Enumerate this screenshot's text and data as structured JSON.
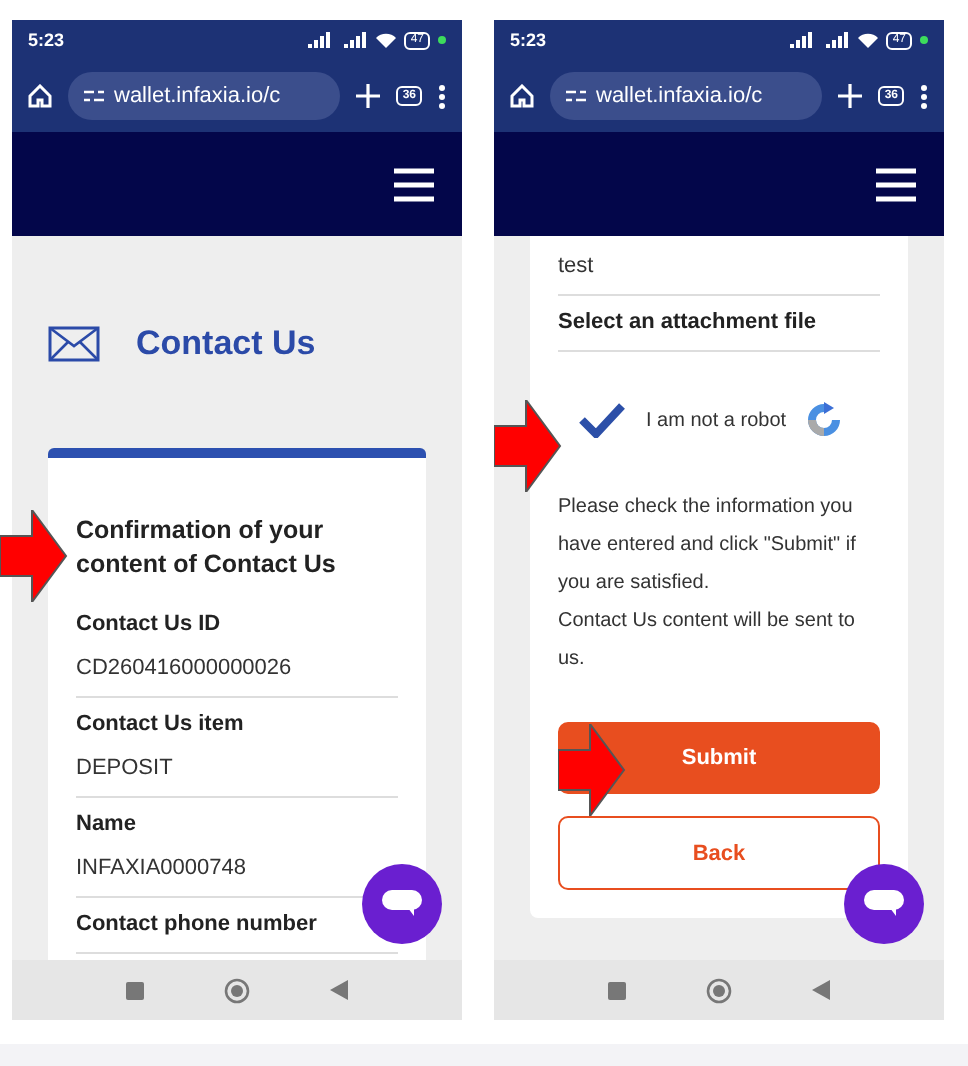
{
  "screens": [
    {
      "status": {
        "time": "5:23",
        "battery": "47"
      },
      "browser": {
        "url": "wallet.infaxia.io/c",
        "tab_count": "36"
      },
      "page_title": "Contact Us",
      "card": {
        "heading": "Confirmation of your content of Contact Us",
        "fields": [
          {
            "label": "Contact Us ID",
            "value": "CD260416000000026"
          },
          {
            "label": "Contact Us item",
            "value": "DEPOSIT"
          },
          {
            "label": "Name",
            "value": "INFAXIA0000748"
          },
          {
            "label": "Contact phone number"
          }
        ]
      }
    },
    {
      "status": {
        "time": "5:23",
        "battery": "47"
      },
      "browser": {
        "url": "wallet.infaxia.io/c",
        "tab_count": "36"
      },
      "card": {
        "fields": [
          {
            "value": "test"
          },
          {
            "label": "Select an attachment file"
          }
        ],
        "captcha": {
          "label": "I am not a robot",
          "checked": true
        },
        "notice": [
          "Please check the information you have entered and click \"Submit\" if you are satisfied.",
          "Contact Us content will be sent to us."
        ],
        "buttons": [
          {
            "label": "Submit",
            "kind": "primary"
          },
          {
            "label": "Back",
            "kind": "secondary"
          }
        ]
      }
    }
  ]
}
